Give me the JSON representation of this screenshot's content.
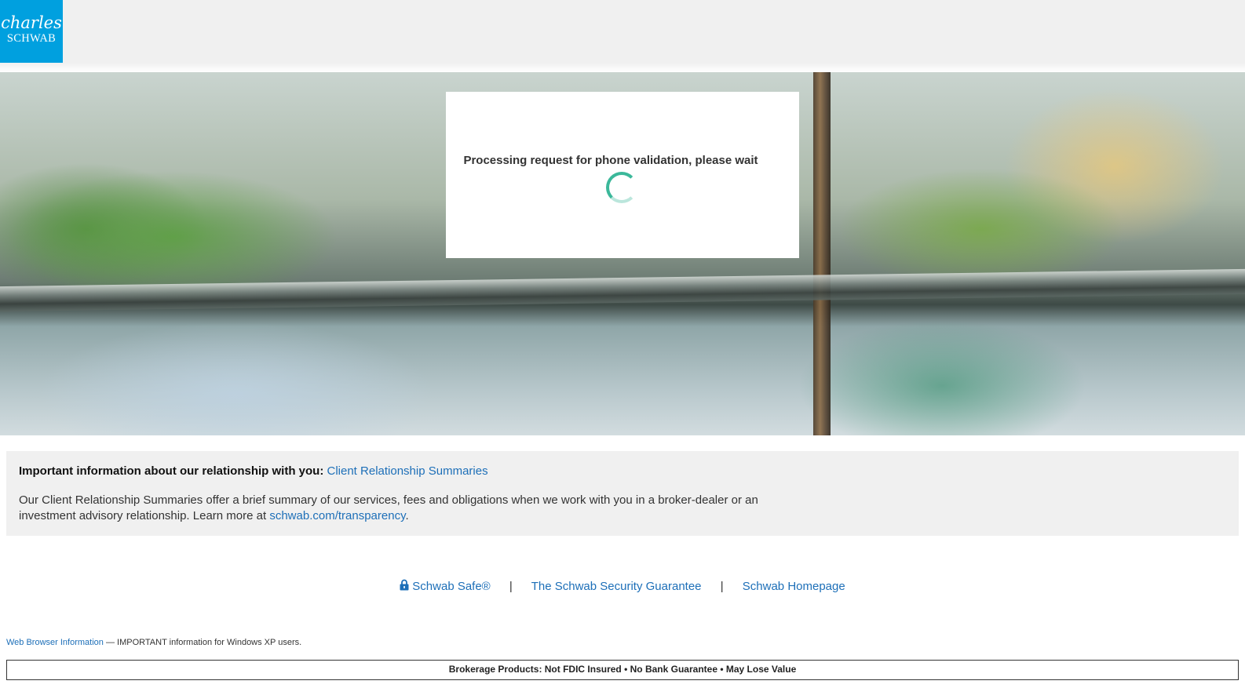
{
  "header": {
    "logo_line1": "charles",
    "logo_line2": "SCHWAB",
    "logo_color": "#00a0df"
  },
  "modal": {
    "message": "Processing request for phone validation, please wait",
    "spinner_color": "#3bb89a"
  },
  "info": {
    "heading": "Important information about our relationship with you:",
    "heading_link": "Client Relationship Summaries",
    "body": "Our Client Relationship Summaries offer a brief summary of our services, fees and obligations when we work with you in a broker-dealer or an investment advisory relationship. Learn more at",
    "body_link": "schwab.com/transparency",
    "body_end": "."
  },
  "footer": {
    "links": [
      "Schwab Safe®",
      "The Schwab Security Guarantee",
      "Schwab Homepage"
    ],
    "separator": "|",
    "lock_icon": "lock-icon"
  },
  "browser_info": {
    "link": "Web Browser Information",
    "text": "— IMPORTANT information for Windows XP users."
  },
  "disclaimer": "Brokerage Products: Not FDIC Insured • No Bank Guarantee • May Lose Value",
  "colors": {
    "link": "#1d6fb8",
    "panel_bg": "#f0f0f0"
  }
}
